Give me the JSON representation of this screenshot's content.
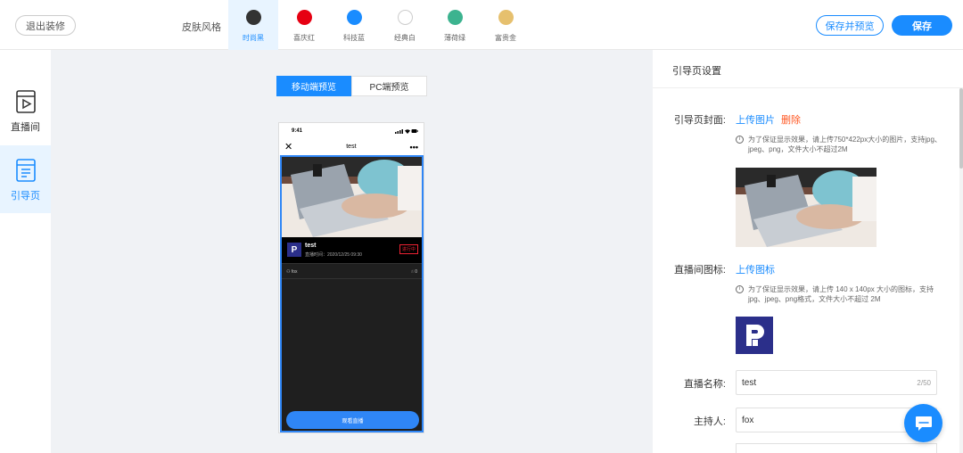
{
  "topbar": {
    "exit_label": "退出装修",
    "skin_label": "皮肤风格",
    "skins": [
      {
        "name": "时尚黑",
        "color": "#333333",
        "active": true
      },
      {
        "name": "喜庆红",
        "color": "#e60012"
      },
      {
        "name": "科技蓝",
        "color": "#1a8cff"
      },
      {
        "name": "经典白",
        "color": "#ffffff"
      },
      {
        "name": "薄荷绿",
        "color": "#3cb38f"
      },
      {
        "name": "富贵金",
        "color": "#e6c06e"
      }
    ],
    "save_preview_label": "保存并预览",
    "save_label": "保存"
  },
  "sidebar": {
    "items": [
      {
        "label": "直播间"
      },
      {
        "label": "引导页",
        "active": true
      }
    ]
  },
  "preview": {
    "tabs": [
      {
        "label": "移动端预览",
        "active": true
      },
      {
        "label": "PC端预览"
      }
    ],
    "phone": {
      "time": "9:41",
      "page_title": "test",
      "live_title": "test",
      "live_time": "直播时间：2020/12/25 09:30",
      "status_badge": "进行中",
      "host": "fox",
      "watch_count": "0",
      "watch_button": "观看直播"
    }
  },
  "settings": {
    "title": "引导页设置",
    "cover_label": "引导页封面:",
    "cover_upload": "上传图片",
    "cover_delete": "删除",
    "cover_tip": "为了保证显示效果，请上传750*422px大小的图片，支持jpg、jpeg、png，文件大小不超过2M",
    "icon_label": "直播间图标:",
    "icon_upload": "上传图标",
    "icon_tip": "为了保证显示效果，请上传 140 x 140px 大小的图标，支持jpg、jpeg、png格式，文件大小不超过 2M",
    "name_label": "直播名称:",
    "name_value": "test",
    "name_count": "2/50",
    "host_label": "主持人:",
    "host_value": "fox"
  }
}
